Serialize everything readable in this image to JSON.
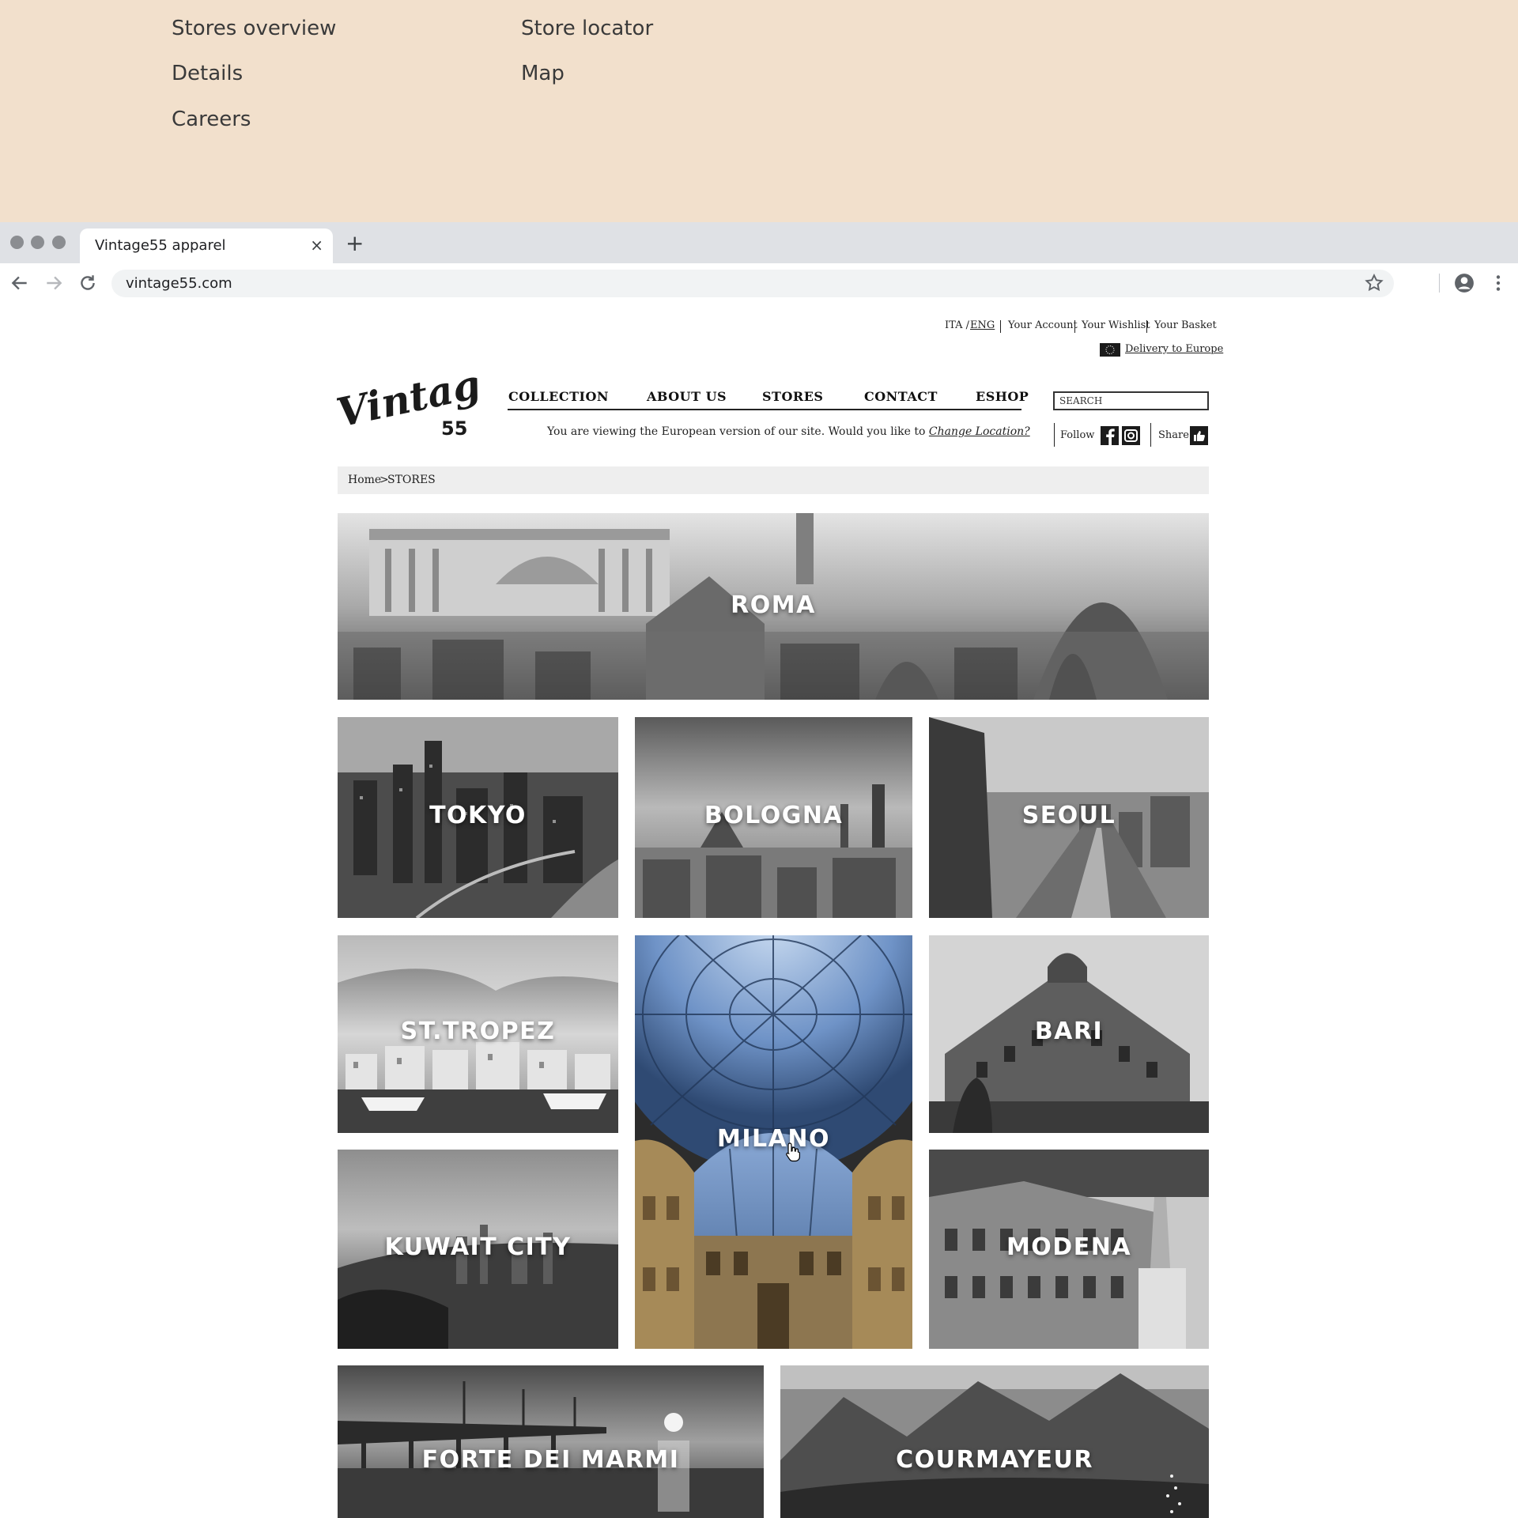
{
  "annotation_links": {
    "stores_overview": "Stores overview",
    "store_locator": "Store locator",
    "details": "Details",
    "map": "Map",
    "careers": "Careers"
  },
  "browser": {
    "tab_title": "Vintage55 apparel",
    "tab_close": "×",
    "new_tab": "+",
    "url": "vintage55.com"
  },
  "utility_nav": {
    "lang_ita": "ITA /",
    "lang_eng": "ENG",
    "account": "Your Account",
    "wishlist": "Your Wishlist",
    "basket": "Your Basket",
    "delivery": "Delivery to Europe"
  },
  "main_nav": {
    "collection": "COLLECTION",
    "about": "ABOUT US",
    "stores": "STORES",
    "contact": "CONTACT",
    "eshop": "ESHOP"
  },
  "location_notice": {
    "text": "You are viewing the European version of our site. Would you like to",
    "link": "Change Location?"
  },
  "search": {
    "placeholder": "SEARCH"
  },
  "social": {
    "follow": "Follow",
    "share": "Share"
  },
  "breadcrumb": {
    "home": "Home",
    "separator": ">",
    "current": "STORES"
  },
  "stores": [
    {
      "name": "ROMA"
    },
    {
      "name": "TOKYO"
    },
    {
      "name": "BOLOGNA"
    },
    {
      "name": "SEOUL"
    },
    {
      "name": "ST.TROPEZ"
    },
    {
      "name": "MILANO"
    },
    {
      "name": "BARI"
    },
    {
      "name": "KUWAIT CITY"
    },
    {
      "name": "MODENA"
    },
    {
      "name": "FORTE DEI MARMI"
    },
    {
      "name": "COURMAYEUR"
    }
  ],
  "colors": {
    "annotation_bg": "#f2e0cc",
    "tab_strip": "#dfe1e5",
    "text_dark": "#111111",
    "milano_accent": "#6f93c7"
  }
}
